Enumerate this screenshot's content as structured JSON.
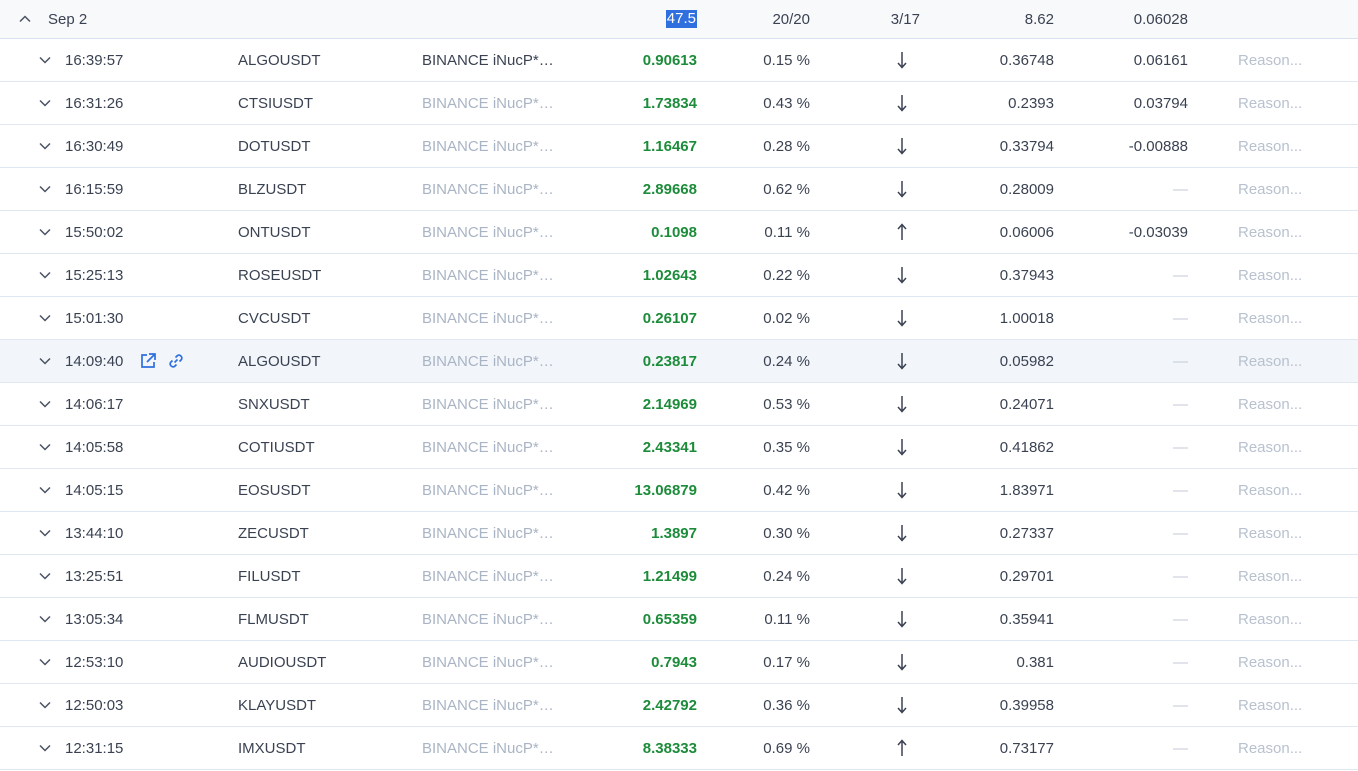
{
  "group": {
    "date": "Sep 2",
    "total": "47.5",
    "count": "20/20",
    "ratio": "3/17",
    "sum1": "8.62",
    "sum2": "0.06028"
  },
  "rows": [
    {
      "time": "16:39:57",
      "symbol": "ALGOUSDT",
      "source": "BINANCE iNucP*…",
      "price": "0.90613",
      "pct": "0.15 %",
      "dir": "down",
      "v1": "0.36748",
      "v2": "0.06161",
      "reason": "Reason..."
    },
    {
      "time": "16:31:26",
      "symbol": "CTSIUSDT",
      "source": "BINANCE iNucP*…",
      "price": "1.73834",
      "pct": "0.43 %",
      "dir": "down",
      "v1": "0.2393",
      "v2": "0.03794",
      "reason": "Reason..."
    },
    {
      "time": "16:30:49",
      "symbol": "DOTUSDT",
      "source": "BINANCE iNucP*…",
      "price": "1.16467",
      "pct": "0.28 %",
      "dir": "down",
      "v1": "0.33794",
      "v2": "-0.00888",
      "reason": "Reason..."
    },
    {
      "time": "16:15:59",
      "symbol": "BLZUSDT",
      "source": "BINANCE iNucP*…",
      "price": "2.89668",
      "pct": "0.62 %",
      "dir": "down",
      "v1": "0.28009",
      "v2": "—",
      "reason": "Reason..."
    },
    {
      "time": "15:50:02",
      "symbol": "ONTUSDT",
      "source": "BINANCE iNucP*…",
      "price": "0.1098",
      "pct": "0.11 %",
      "dir": "up",
      "v1": "0.06006",
      "v2": "-0.03039",
      "reason": "Reason..."
    },
    {
      "time": "15:25:13",
      "symbol": "ROSEUSDT",
      "source": "BINANCE iNucP*…",
      "price": "1.02643",
      "pct": "0.22 %",
      "dir": "down",
      "v1": "0.37943",
      "v2": "—",
      "reason": "Reason..."
    },
    {
      "time": "15:01:30",
      "symbol": "CVCUSDT",
      "source": "BINANCE iNucP*…",
      "price": "0.26107",
      "pct": "0.02 %",
      "dir": "down",
      "v1": "1.00018",
      "v2": "—",
      "reason": "Reason..."
    },
    {
      "time": "14:09:40",
      "symbol": "ALGOUSDT",
      "source": "BINANCE iNucP*…",
      "price": "0.23817",
      "pct": "0.24 %",
      "dir": "down",
      "v1": "0.05982",
      "v2": "—",
      "reason": "Reason..."
    },
    {
      "time": "14:06:17",
      "symbol": "SNXUSDT",
      "source": "BINANCE iNucP*…",
      "price": "2.14969",
      "pct": "0.53 %",
      "dir": "down",
      "v1": "0.24071",
      "v2": "—",
      "reason": "Reason..."
    },
    {
      "time": "14:05:58",
      "symbol": "COTIUSDT",
      "source": "BINANCE iNucP*…",
      "price": "2.43341",
      "pct": "0.35 %",
      "dir": "down",
      "v1": "0.41862",
      "v2": "—",
      "reason": "Reason..."
    },
    {
      "time": "14:05:15",
      "symbol": "EOSUSDT",
      "source": "BINANCE iNucP*…",
      "price": "13.06879",
      "pct": "0.42 %",
      "dir": "down",
      "v1": "1.83971",
      "v2": "—",
      "reason": "Reason..."
    },
    {
      "time": "13:44:10",
      "symbol": "ZECUSDT",
      "source": "BINANCE iNucP*…",
      "price": "1.3897",
      "pct": "0.30 %",
      "dir": "down",
      "v1": "0.27337",
      "v2": "—",
      "reason": "Reason..."
    },
    {
      "time": "13:25:51",
      "symbol": "FILUSDT",
      "source": "BINANCE iNucP*…",
      "price": "1.21499",
      "pct": "0.24 %",
      "dir": "down",
      "v1": "0.29701",
      "v2": "—",
      "reason": "Reason..."
    },
    {
      "time": "13:05:34",
      "symbol": "FLMUSDT",
      "source": "BINANCE iNucP*…",
      "price": "0.65359",
      "pct": "0.11 %",
      "dir": "down",
      "v1": "0.35941",
      "v2": "—",
      "reason": "Reason..."
    },
    {
      "time": "12:53:10",
      "symbol": "AUDIOUSDT",
      "source": "BINANCE iNucP*…",
      "price": "0.7943",
      "pct": "0.17 %",
      "dir": "down",
      "v1": "0.381",
      "v2": "—",
      "reason": "Reason..."
    },
    {
      "time": "12:50:03",
      "symbol": "KLAYUSDT",
      "source": "BINANCE iNucP*…",
      "price": "2.42792",
      "pct": "0.36 %",
      "dir": "down",
      "v1": "0.39958",
      "v2": "—",
      "reason": "Reason..."
    },
    {
      "time": "12:31:15",
      "symbol": "IMXUSDT",
      "source": "BINANCE iNucP*…",
      "price": "8.38333",
      "pct": "0.69 %",
      "dir": "up",
      "v1": "0.73177",
      "v2": "—",
      "reason": "Reason..."
    }
  ],
  "colors": {
    "price": "#1d8c3a",
    "selection": "#2f6fde",
    "action_icons": "#2f6fde",
    "muted": "#a9b4c4",
    "row_highlight": "#f2f6fb"
  },
  "icons": {
    "collapse": "chevron-up-icon",
    "expand": "chevron-down-icon",
    "open": "external-link-icon",
    "link": "link-icon",
    "down": "arrow-down-icon",
    "up": "arrow-up-icon"
  }
}
